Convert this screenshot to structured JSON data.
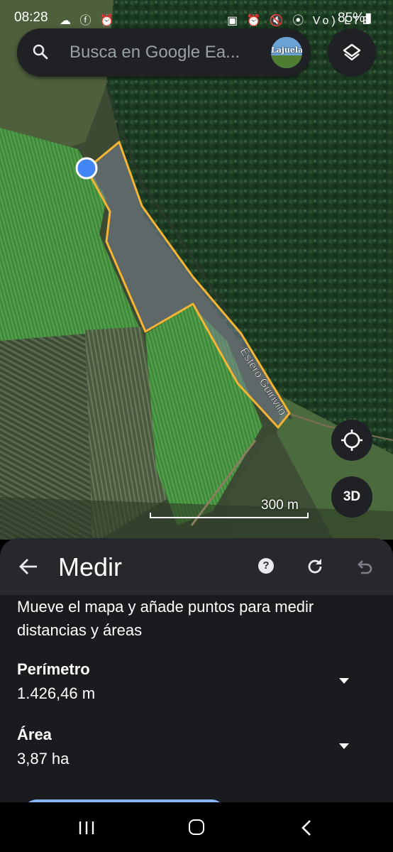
{
  "status_bar": {
    "time": "08:28",
    "left_icons": "☁ ⓕ ⏰",
    "right_icons": "▣ ⏰ 🔇 ⦿ Vo) LTE 5G",
    "battery": "85%▮"
  },
  "search": {
    "placeholder": "Busca en Google Ea...",
    "avatar_text": "Lajuela"
  },
  "map": {
    "river_label": "Estero Guirivilo",
    "scale_label": "300 m",
    "three_d_label": "3D",
    "colors": {
      "measure_outline": "#f5b533",
      "location_dot": "#4285f4"
    }
  },
  "measure": {
    "title": "Medir",
    "help_label": "?",
    "instructions": "Mueve el mapa y añade puntos para medir distancias y áreas",
    "perimeter_label": "Perímetro",
    "perimeter_value": "1.426,46 m",
    "area_label": "Área",
    "area_value": "3,87 ha"
  }
}
